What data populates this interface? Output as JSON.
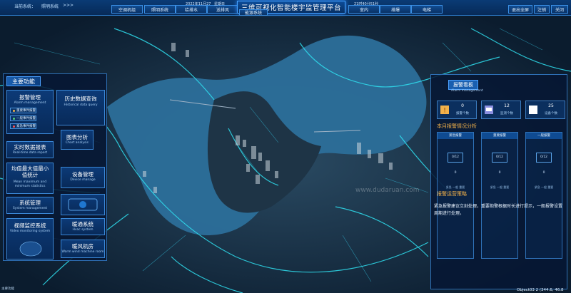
{
  "topbar": {
    "crumb_current": "当前系统：",
    "crumb_system": "照明系统",
    "crumb_arrow": ">>>",
    "nav": [
      "空调机组",
      "照明系统",
      "给排水",
      "送排风",
      "能源系统",
      "室内",
      "排爆",
      "电梯"
    ],
    "date": "2022年11月27",
    "weekday": "星期日",
    "time": "21时40分51秒",
    "title": "三维可视化智能楼宇监管理平台",
    "actions": [
      "退出全屏",
      "注销",
      "关闭"
    ]
  },
  "left_panel": {
    "title": "主要功能",
    "tiles": [
      {
        "label": "报警管理",
        "sub": "Alarm management"
      },
      {
        "label": "历史数据查询",
        "sub": "Historical data query"
      },
      {
        "label": "图表分析",
        "sub": "Chart analysis"
      },
      {
        "label": "实时数据报表",
        "sub": "Real-time data report"
      },
      {
        "label": "均值最大值最小值统计",
        "sub": "Mean maximum and minimum statistics"
      },
      {
        "label": "设备管理",
        "sub": "Device manage"
      },
      {
        "label": "系统管理",
        "sub": "System management"
      },
      {
        "label": "视频监控系统",
        "sub": "Video monitoring system"
      },
      {
        "label": "暖通系统",
        "sub": "Hvac system"
      },
      {
        "label": "暖风机房",
        "sub": "Warm wind machine room"
      }
    ],
    "alarm_subs": [
      "重要事件报警",
      "一般事件报警",
      "紧急事件报警"
    ]
  },
  "right_panel": {
    "alarm_title": "报警看板",
    "alarm_sub": "Alarm management",
    "stats": [
      {
        "num": "0",
        "label": "报警个数"
      },
      {
        "num": "12",
        "label": "监测个数"
      },
      {
        "num": "25",
        "label": "设备个数"
      }
    ],
    "month_title": "本月报警情况分析",
    "columns": [
      {
        "head": "紧急报警",
        "box": "0/12",
        "zero": "0",
        "vals": "紧急 一般 重要"
      },
      {
        "head": "重要报警",
        "box": "0/12",
        "zero": "0",
        "vals": "紧急 一般 重要"
      },
      {
        "head": "一般报警",
        "box": "0/12",
        "zero": "0",
        "vals": "紧急 一般 重要"
      }
    ],
    "plan_title": "报警运营策略",
    "plan_text": "紧急报警建议立刻处理，重要抱警根据时长进行提示，一般报警设置周期进行处理。"
  },
  "footer": {
    "left": "主要功能",
    "right": "Object03 2 (344.6, 46.8"
  },
  "watermark": "www.dudaruan.com",
  "colors": {
    "accent": "#45a3ff",
    "panel": "#061634",
    "glow": "#2fe0f0",
    "river": "#2c6f9a",
    "warning": "#f3b24a"
  }
}
